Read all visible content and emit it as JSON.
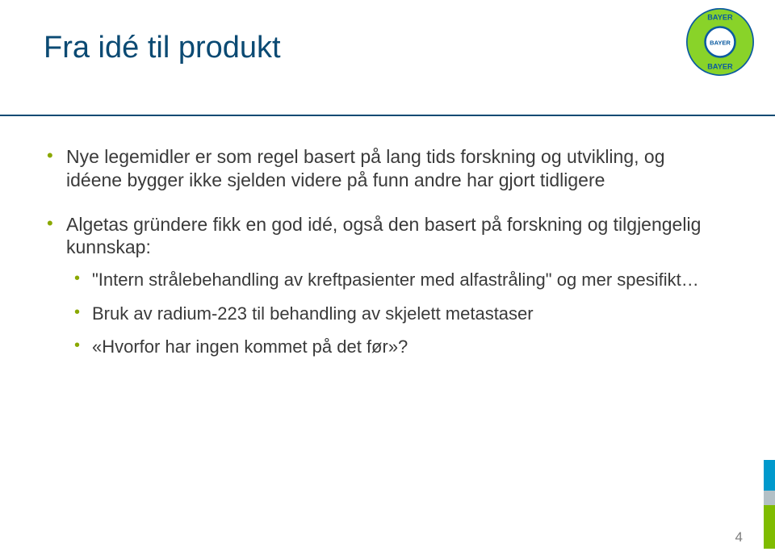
{
  "title": "Fra idé til produkt",
  "bullets": [
    "Nye legemidler er som regel basert på lang tids forskning og utvikling, og idéene bygger ikke sjelden videre på funn andre har gjort tidligere",
    "Algetas gründere fikk en god idé, også den basert på forskning og tilgjengelig kunnskap:"
  ],
  "sub_bullets": [
    "\"Intern strålebehandling av kreftpasienter med alfastråling\" og mer spesifikt…",
    "Bruk av radium-223 til behandling av skjelett metastaser",
    "«Hvorfor har ingen kommet på det før»?"
  ],
  "page_number": "4",
  "logo": {
    "top": "BAYER",
    "bottom": "BAYER",
    "inner": "BAYER"
  }
}
